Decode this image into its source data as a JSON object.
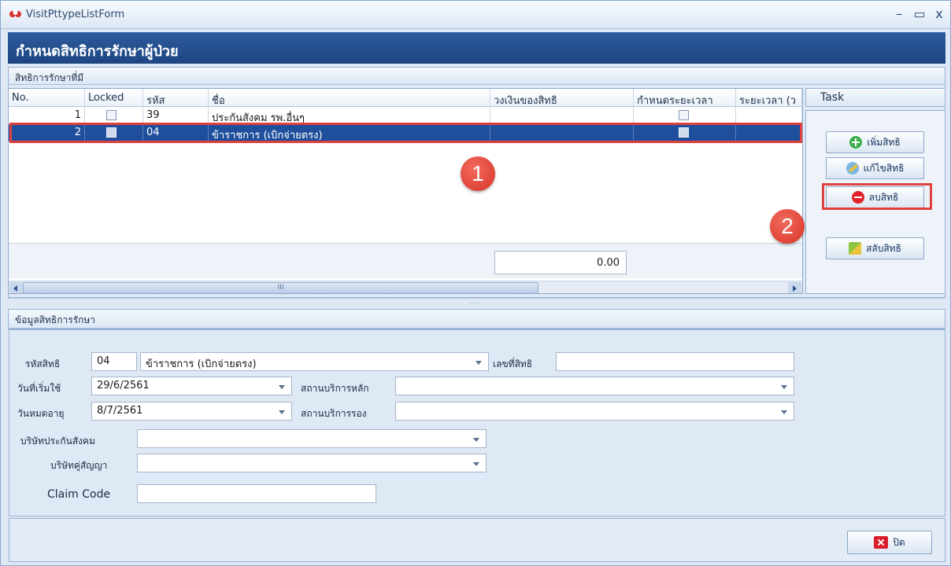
{
  "window": {
    "title": "VisitPttypeListForm",
    "minimize": "–",
    "maximize": "▭",
    "close": "x"
  },
  "header": {
    "title": "กำหนดสิทธิการรักษาผู้ป่วย"
  },
  "list_group": {
    "caption": "สิทธิการรักษาที่มี"
  },
  "grid": {
    "columns": [
      "No.",
      "Locked",
      "รหัส",
      "ชื่อ",
      "วงเงินของสิทธิ",
      "กำหนดระยะเวลา",
      "ระยะเวลา (ว"
    ],
    "rows": [
      {
        "no": "1",
        "locked": false,
        "code": "39",
        "name": "ประกันสังคม รพ.อื่นๆ",
        "limit": "",
        "has_period": false,
        "period": ""
      },
      {
        "no": "2",
        "locked": false,
        "code": "04",
        "name": "ข้าราชการ (เบิกจ่ายตรง)",
        "limit": "",
        "has_period": false,
        "period": ""
      }
    ],
    "selected_row": 2,
    "total": "0.00",
    "scroll_thumb": "III"
  },
  "task": {
    "caption": "Task",
    "buttons": {
      "add": "เพิ่มสิทธิ",
      "edit": "แก้ไขสิทธิ",
      "delete": "ลบสิทธิ",
      "swap": "สลับสิทธิ"
    }
  },
  "annotations": {
    "badge1": "1",
    "badge2": "2"
  },
  "splitter_dots": "....",
  "detail_group": {
    "caption": "ข้อมูลสิทธิการรักษา",
    "fields": {
      "pttype_code_label": "รหัสสิทธิ",
      "pttype_code": "04",
      "pttype_name": "ข้าราชการ (เบิกจ่ายตรง)",
      "card_no_label": "เลขที่สิทธิ",
      "card_no": "",
      "begin_date_label": "วันที่เริ่มใช้",
      "begin_date": "29/6/2561",
      "main_hospital_label": "สถานบริการหลัก",
      "main_hospital": "",
      "expire_date_label": "วันหมดอายุ",
      "expire_date": "8/7/2561",
      "sub_hospital_label": "สถานบริการรอง",
      "sub_hospital": "",
      "sso_company_label": "บริษัทประกันสังคม",
      "sso_company": "",
      "contract_company_label": "บริษัทคู่สัญญา",
      "contract_company": "",
      "claim_code_label": "Claim Code",
      "claim_code": ""
    }
  },
  "footer": {
    "close_label": "ปิด"
  },
  "colors": {
    "header_bg": "#1d4582",
    "selected_row": "#1f4f9c",
    "annotation_red": "#e0413c"
  }
}
